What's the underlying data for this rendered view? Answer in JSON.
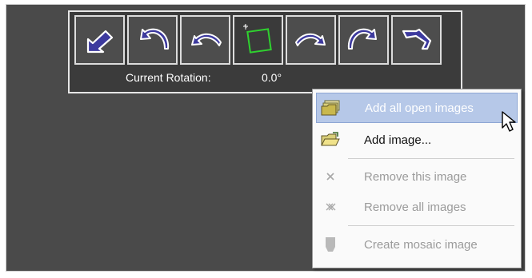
{
  "toolbar": {
    "buttons": [
      {
        "name": "rotate-left-90",
        "icon": "rotate-left-90-icon"
      },
      {
        "name": "rotate-left-small",
        "icon": "rotate-left-arc-icon"
      },
      {
        "name": "rotate-left-fine",
        "icon": "rotate-left-fine-icon"
      },
      {
        "name": "free-rotate",
        "icon": "free-rotate-icon"
      },
      {
        "name": "rotate-right-fine",
        "icon": "rotate-right-fine-icon"
      },
      {
        "name": "rotate-right-small",
        "icon": "rotate-right-arc-icon"
      },
      {
        "name": "rotate-right-90",
        "icon": "rotate-right-90-icon"
      }
    ],
    "rotation_label": "Current Rotation:",
    "rotation_value": "0.0°"
  },
  "context_menu": {
    "items": [
      {
        "label": "Add all open images",
        "icon": "folder-stack-icon",
        "enabled": true,
        "highlighted": true
      },
      {
        "label": "Add image...",
        "icon": "open-folder-icon",
        "enabled": true,
        "highlighted": false
      },
      {
        "label": "Remove this image",
        "icon": "remove-x-icon",
        "enabled": false,
        "highlighted": false
      },
      {
        "label": "Remove all images",
        "icon": "remove-all-icon",
        "enabled": false,
        "highlighted": false
      },
      {
        "label": "Create mosaic image",
        "icon": "mosaic-icon",
        "enabled": false,
        "highlighted": false
      }
    ]
  },
  "colors": {
    "canvas": "#4a4a4a",
    "toolbar_arrow": "#3d3a9e",
    "selection_green": "#2fd12f",
    "menu_highlight": "#b6c8e8"
  }
}
